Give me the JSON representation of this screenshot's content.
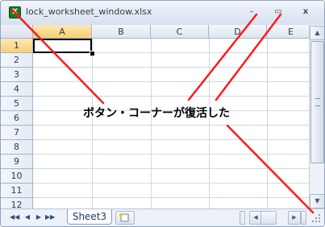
{
  "window": {
    "title": "lock_worksheet_window.xlsx",
    "app_icon": "excel-icon",
    "minimize_glyph": "–",
    "maximize_glyph": "▭",
    "close_glyph": "x"
  },
  "grid": {
    "columns": [
      "A",
      "B",
      "C",
      "D",
      "E"
    ],
    "rows": [
      "1",
      "2",
      "3",
      "4",
      "5",
      "6",
      "7",
      "8",
      "9",
      "10",
      "11",
      "12"
    ],
    "active_cell": "A1"
  },
  "sheet_tabs": {
    "nav_glyphs": [
      "◀◀",
      "◀",
      "▶",
      "▶▶"
    ],
    "active_tab": "Sheet3"
  },
  "annotation": {
    "caption": "ボタン・コーナーが復活した",
    "arrow_color": "#ff1a1a"
  },
  "colors": {
    "header_bg": "#dfe6f0",
    "active_header_bg": "#f9cf73",
    "gridline": "#d0d7e5"
  }
}
